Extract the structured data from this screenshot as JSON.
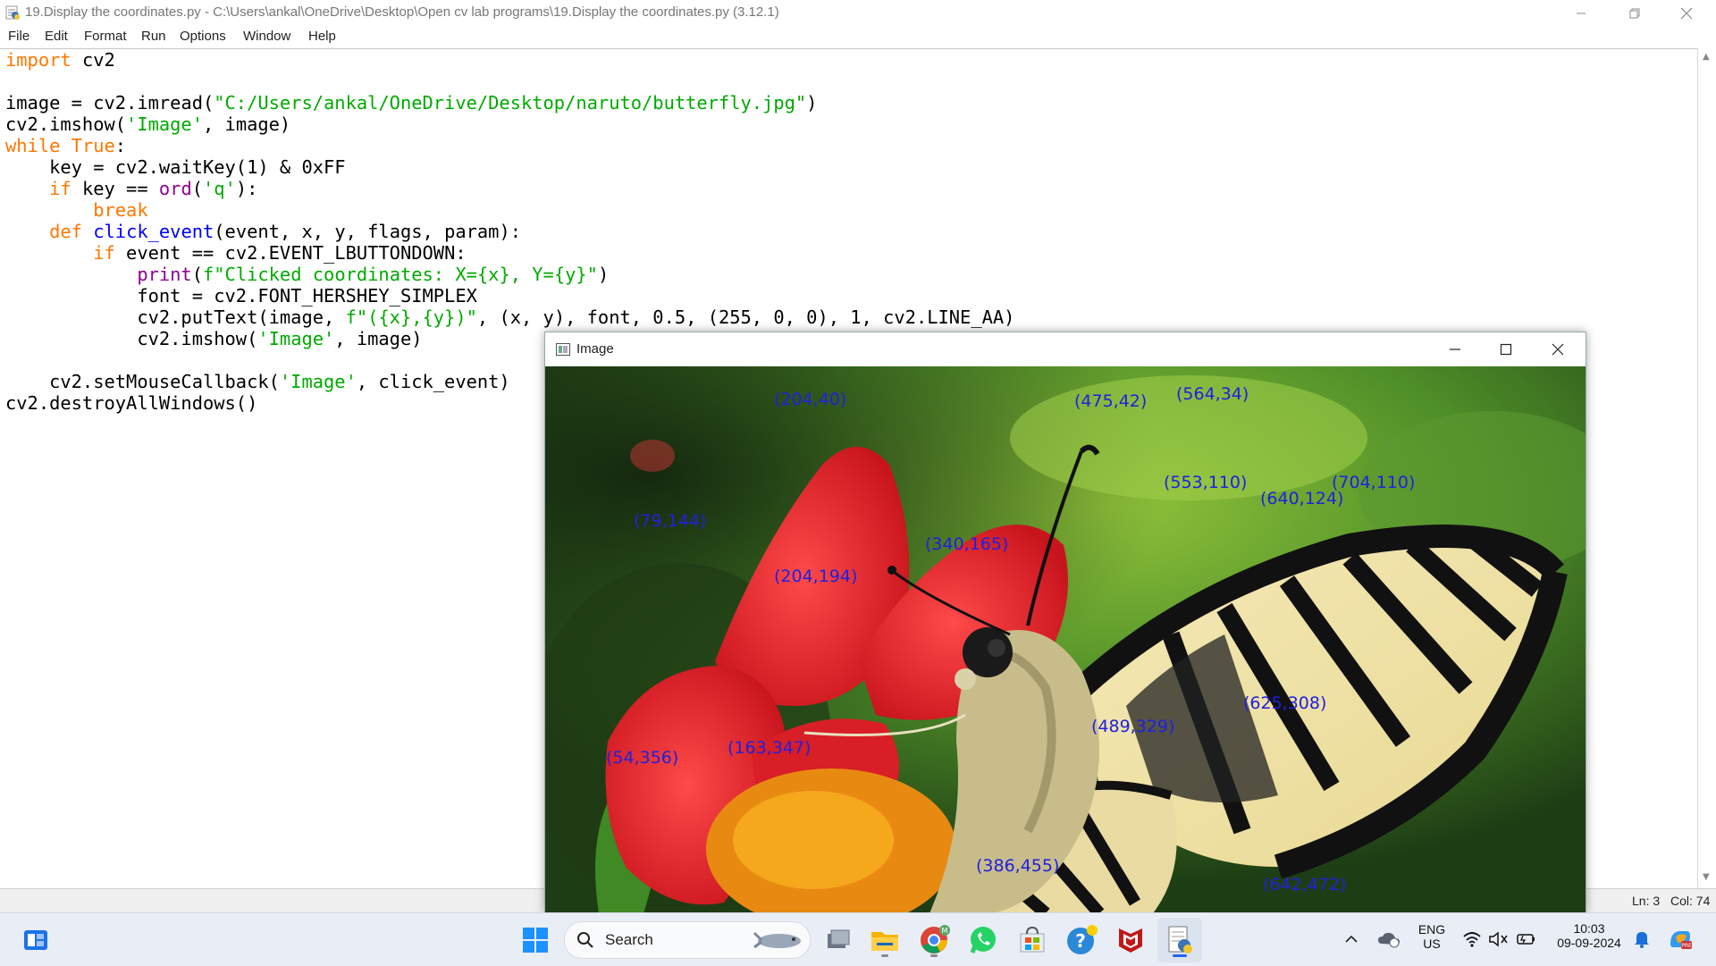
{
  "window": {
    "title": "19.Display the coordinates.py - C:\\Users\\ankal\\OneDrive\\Desktop\\Open cv lab programs\\19.Display the coordinates.py (3.12.1)"
  },
  "menu": [
    "File",
    "Edit",
    "Format",
    "Run",
    "Options",
    "Window",
    "Help"
  ],
  "status": {
    "line": "Ln: 3",
    "col": "Col: 74"
  },
  "image_window": {
    "title": "Image",
    "coordinates": [
      "(204,40)",
      "(475,42)",
      "(564,34)",
      "(553,110)",
      "(640,124)",
      "(704,110)",
      "(79,144)",
      "(340,165)",
      "(204,194)",
      "(489,329)",
      "(625,308)",
      "(54,356)",
      "(163,347)",
      "(386,455)",
      "(642,472)"
    ]
  },
  "taskbar": {
    "search_label": "Search",
    "language": "ENG",
    "region": "US",
    "time": "10:03",
    "date": "09-09-2024"
  },
  "colors": {
    "keyword": "#ff7700",
    "string": "#00aa00",
    "builtin": "#900090",
    "def": "#0000ff",
    "coord_text": "#2020e0"
  },
  "icons": [
    "python-idle-icon",
    "windows-start-icon",
    "search-icon",
    "task-view-icon",
    "file-explorer-icon",
    "chrome-icon",
    "whatsapp-icon",
    "microsoft-store-icon",
    "help-icon",
    "mcafee-icon",
    "python-icon",
    "chevron-up-icon",
    "onedrive-icon",
    "wifi-icon",
    "volume-muted-icon",
    "battery-icon",
    "notification-bell-icon",
    "copilot-icon"
  ]
}
